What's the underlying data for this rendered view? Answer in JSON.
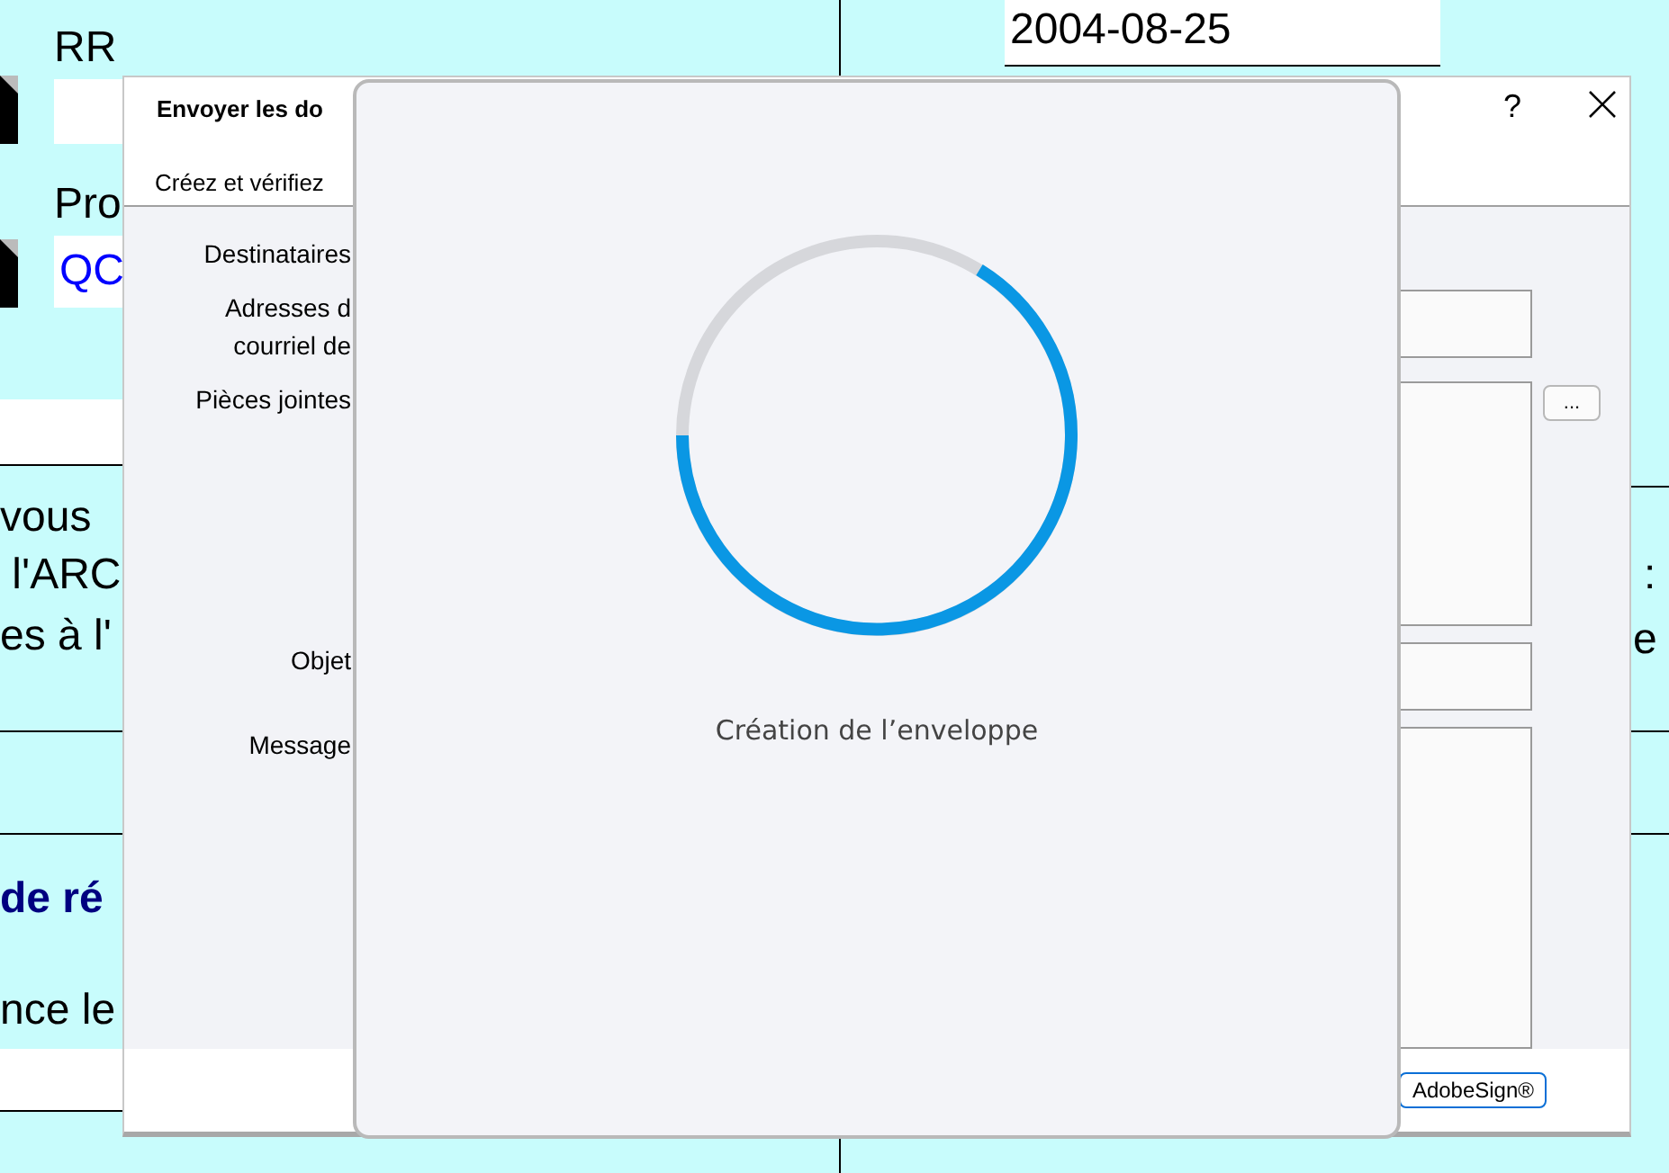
{
  "background_form": {
    "texts": [
      {
        "kind": "label",
        "text": "RR"
      },
      {
        "kind": "label",
        "text": "Pro"
      },
      {
        "kind": "value",
        "text": "QC"
      },
      {
        "kind": "date",
        "text": "2004-08-25"
      },
      {
        "kind": "body",
        "text": "vous "
      },
      {
        "kind": "body",
        "text": " l'ARC"
      },
      {
        "kind": "body",
        "text": "es à l'"
      },
      {
        "kind": "body",
        "text": ":"
      },
      {
        "kind": "body",
        "text": "e"
      },
      {
        "kind": "heading",
        "text": "de ré"
      },
      {
        "kind": "body",
        "text": "nce le"
      }
    ]
  },
  "dialog": {
    "title": "Envoyer les do",
    "subtitle": "Créez et vérifiez",
    "help": "?",
    "fields": [
      {
        "label": "Destinataires",
        "kind": "none"
      },
      {
        "label": "Adresses d\ncourriel de",
        "kind": "line"
      },
      {
        "label": "Pièces jointes",
        "kind": "area",
        "button": "..."
      },
      {
        "label": "Objet",
        "kind": "line"
      },
      {
        "label": "Message",
        "kind": "message"
      }
    ],
    "footer_button": "AdobeSign®"
  },
  "overlay": {
    "status": "Création de l’enveloppe"
  }
}
